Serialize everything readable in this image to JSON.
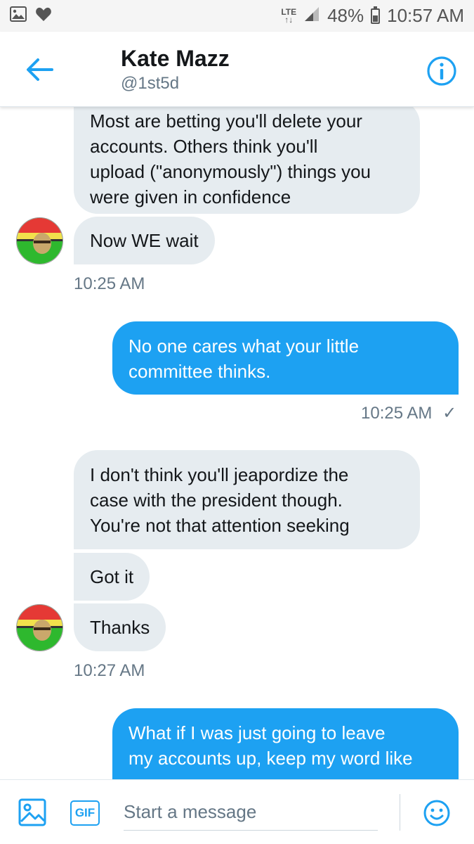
{
  "status_bar": {
    "network": "LTE",
    "battery": "48%",
    "time": "10:57 AM",
    "icons": [
      "image-icon",
      "heart-icon",
      "signal-icon",
      "battery-icon"
    ]
  },
  "header": {
    "contact_name": "Kate Mazz",
    "contact_handle": "@1st5d",
    "back_icon": "arrow-left-icon",
    "info_icon": "info-icon"
  },
  "messages": [
    {
      "direction": "in",
      "lines": [
        "Most are betting you'll delete your",
        "accounts.  Others think you'll",
        "upload (\"anonymously\") things you",
        "were given in confidence"
      ]
    },
    {
      "direction": "in",
      "lines": [
        "Now WE wait"
      ]
    },
    {
      "type": "timestamp",
      "text": "10:25 AM"
    },
    {
      "direction": "out",
      "lines": [
        "No one cares what your little",
        "committee thinks."
      ]
    },
    {
      "type": "timestamp",
      "text": "10:25 AM",
      "status": "✓"
    },
    {
      "direction": "in",
      "lines": [
        "I don't think you'll jeapordize the",
        "case with the president though.",
        "You're not that attention seeking"
      ]
    },
    {
      "direction": "in",
      "lines": [
        "Got it"
      ]
    },
    {
      "direction": "in",
      "lines": [
        "Thanks"
      ]
    },
    {
      "type": "timestamp",
      "text": "10:27 AM"
    },
    {
      "direction": "out",
      "lines": [
        "What if I was just going to leave",
        "my accounts up, keep my word like"
      ]
    }
  ],
  "composer": {
    "placeholder": "Start a message",
    "gif_label": "GIF",
    "media_icon": "image-icon",
    "emoji_icon": "emoji-icon"
  },
  "colors": {
    "accent": "#1da1f2",
    "incoming_bubble": "#e6ecf0",
    "text_secondary": "#657786"
  }
}
